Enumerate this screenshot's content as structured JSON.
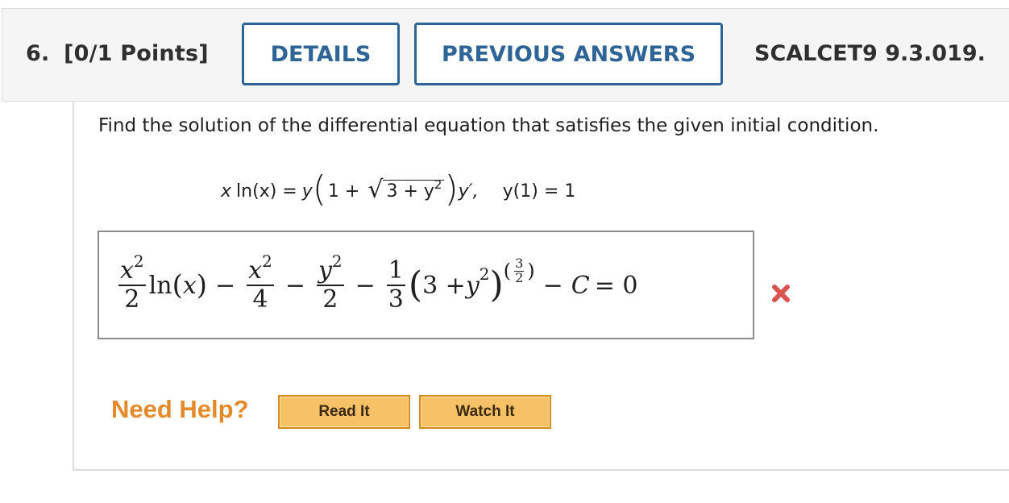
{
  "header": {
    "question_number": "6.",
    "points": "[0/1 Points]",
    "details_label": "DETAILS",
    "previous_answers_label": "PREVIOUS ANSWERS",
    "reference": "SCALCET9 9.3.019."
  },
  "question": {
    "prompt": "Find the solution of the differential equation that satisfies the given initial condition.",
    "eq_lhs_x": "x",
    "eq_lhs_ln": "ln(x) = ",
    "eq_y": "y",
    "eq_inner_one_plus": "1 +",
    "eq_radicand": "3 + y",
    "eq_exp2": "2",
    "eq_yprime": "y′,",
    "initial_condition": "y(1) = 1"
  },
  "answer": {
    "t1_num": "x",
    "t1_exp": "2",
    "t1_den": "2",
    "t1_ln": "ln",
    "t1_arg": "x",
    "minus": "−",
    "t2_num": "x",
    "t2_exp": "2",
    "t2_den": "4",
    "t3_num": "y",
    "t3_exp": "2",
    "t3_den": "2",
    "t4_num": "1",
    "t4_den": "3",
    "t4_three_plus": "3 + ",
    "t4_y": "y",
    "t4_yexp": "2",
    "t4_pow_num": "3",
    "t4_pow_den": "2",
    "t5": "C",
    "eq_zero": "= 0",
    "status": "incorrect",
    "status_color": "#d9534f"
  },
  "help": {
    "label": "Need Help?",
    "read_it": "Read It",
    "watch_it": "Watch It"
  },
  "colors": {
    "accent": "#2e6496",
    "help_orange": "#e48a2a",
    "button_fill": "#f7c167"
  }
}
